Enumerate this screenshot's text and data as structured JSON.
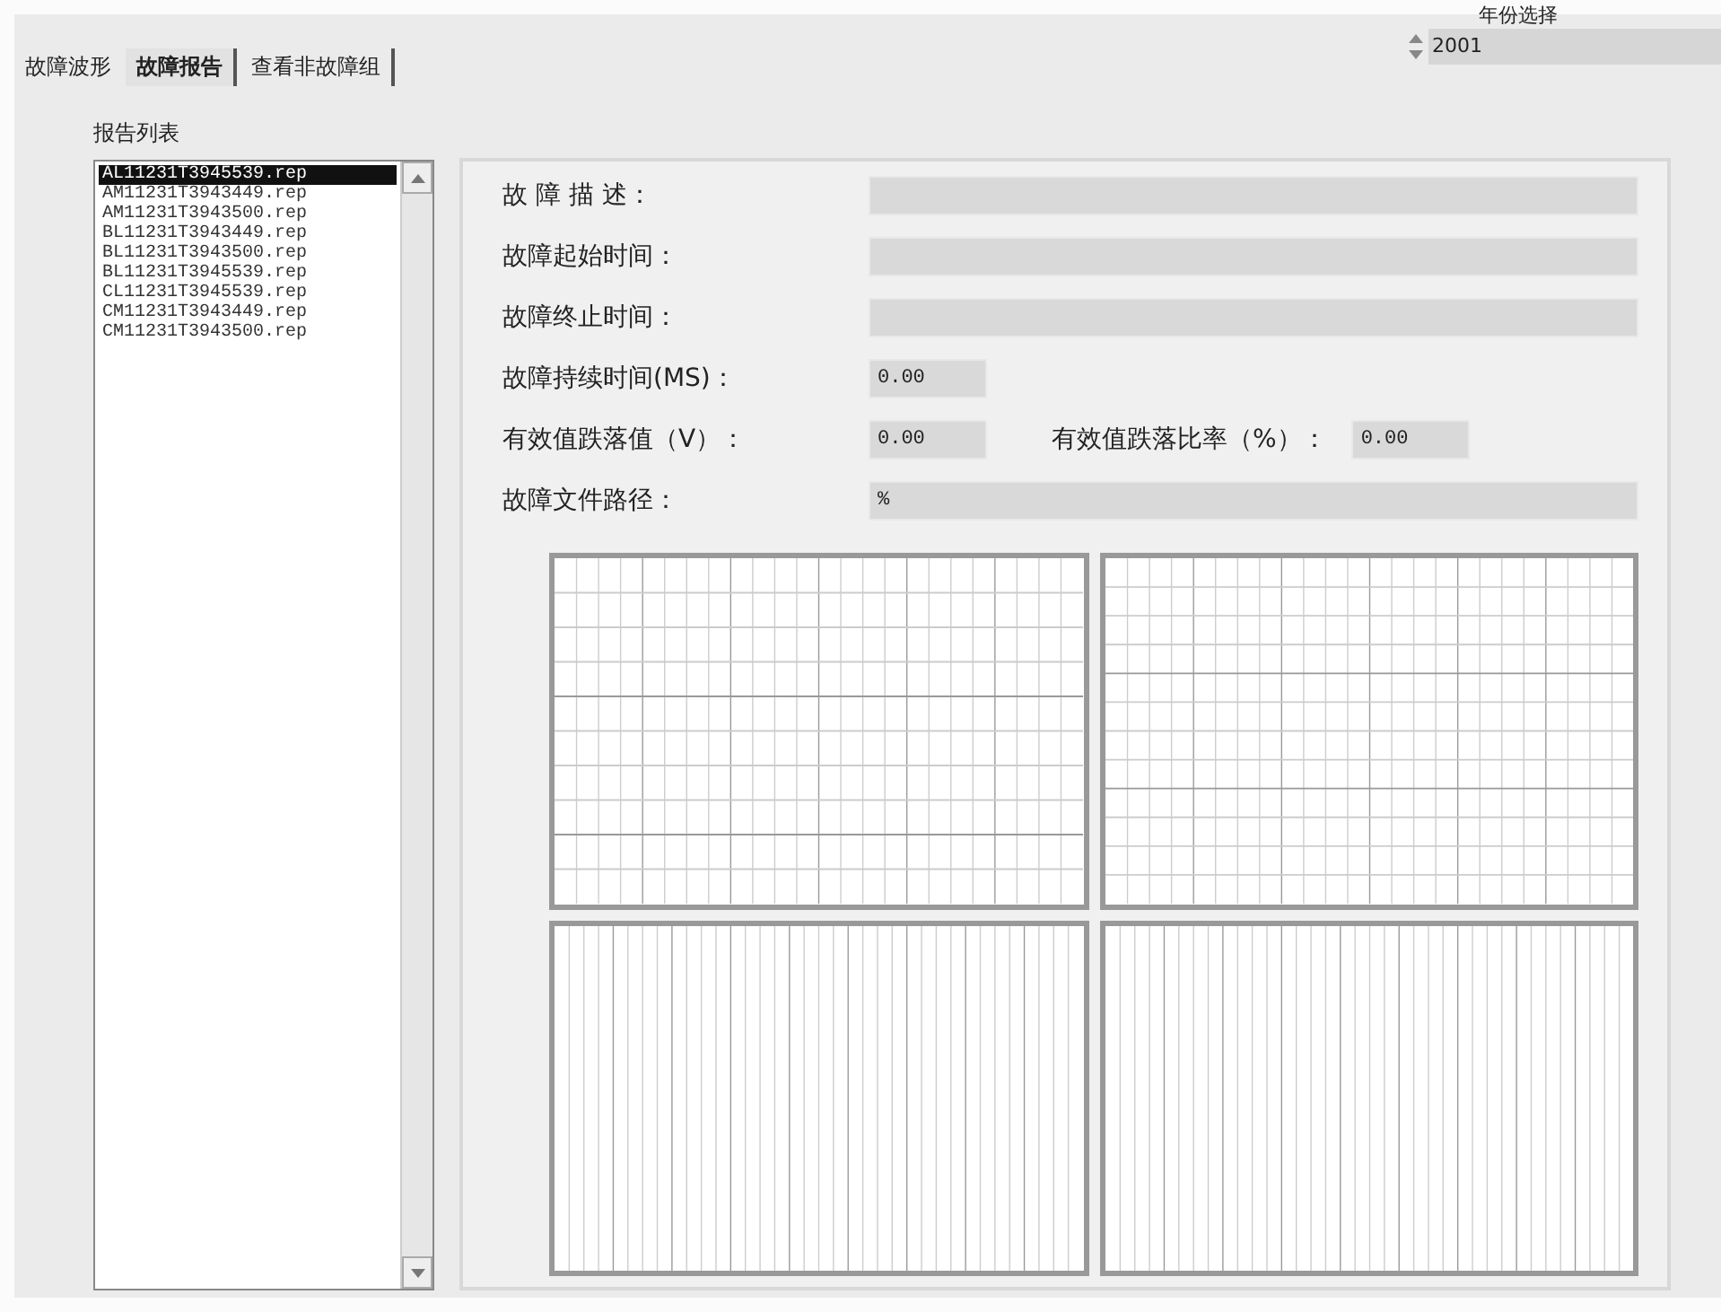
{
  "tabs": [
    {
      "label": "故障波形",
      "selected": false
    },
    {
      "label": "故障报告",
      "selected": true
    },
    {
      "label": "查看非故障组",
      "selected": false
    }
  ],
  "year_select": {
    "label": "年份选择",
    "value": "2001"
  },
  "report_list": {
    "title": "报告列表",
    "items": [
      {
        "label": "AL11231T3945539.rep",
        "selected": true
      },
      {
        "label": "AM11231T3943449.rep",
        "selected": false
      },
      {
        "label": "AM11231T3943500.rep",
        "selected": false
      },
      {
        "label": "BL11231T3943449.rep",
        "selected": false
      },
      {
        "label": "BL11231T3943500.rep",
        "selected": false
      },
      {
        "label": "BL11231T3945539.rep",
        "selected": false
      },
      {
        "label": "CL11231T3945539.rep",
        "selected": false
      },
      {
        "label": "CM11231T3943449.rep",
        "selected": false
      },
      {
        "label": "CM11231T3943500.rep",
        "selected": false
      }
    ]
  },
  "fault_details": {
    "description": {
      "label": "故 障 描 述："
    },
    "start_time": {
      "label": "故障起始时间："
    },
    "end_time": {
      "label": "故障终止时间："
    },
    "duration": {
      "label": "故障持续时间(MS)：",
      "value": "0.00"
    },
    "rms_drop": {
      "label": "有效值跌落值（V）：",
      "value": "0.00"
    },
    "rms_drop_ratio": {
      "label": "有效值跌落比率（%）：",
      "value": "0.00"
    },
    "file_path": {
      "label": "故障文件路径：",
      "value": "%"
    }
  }
}
